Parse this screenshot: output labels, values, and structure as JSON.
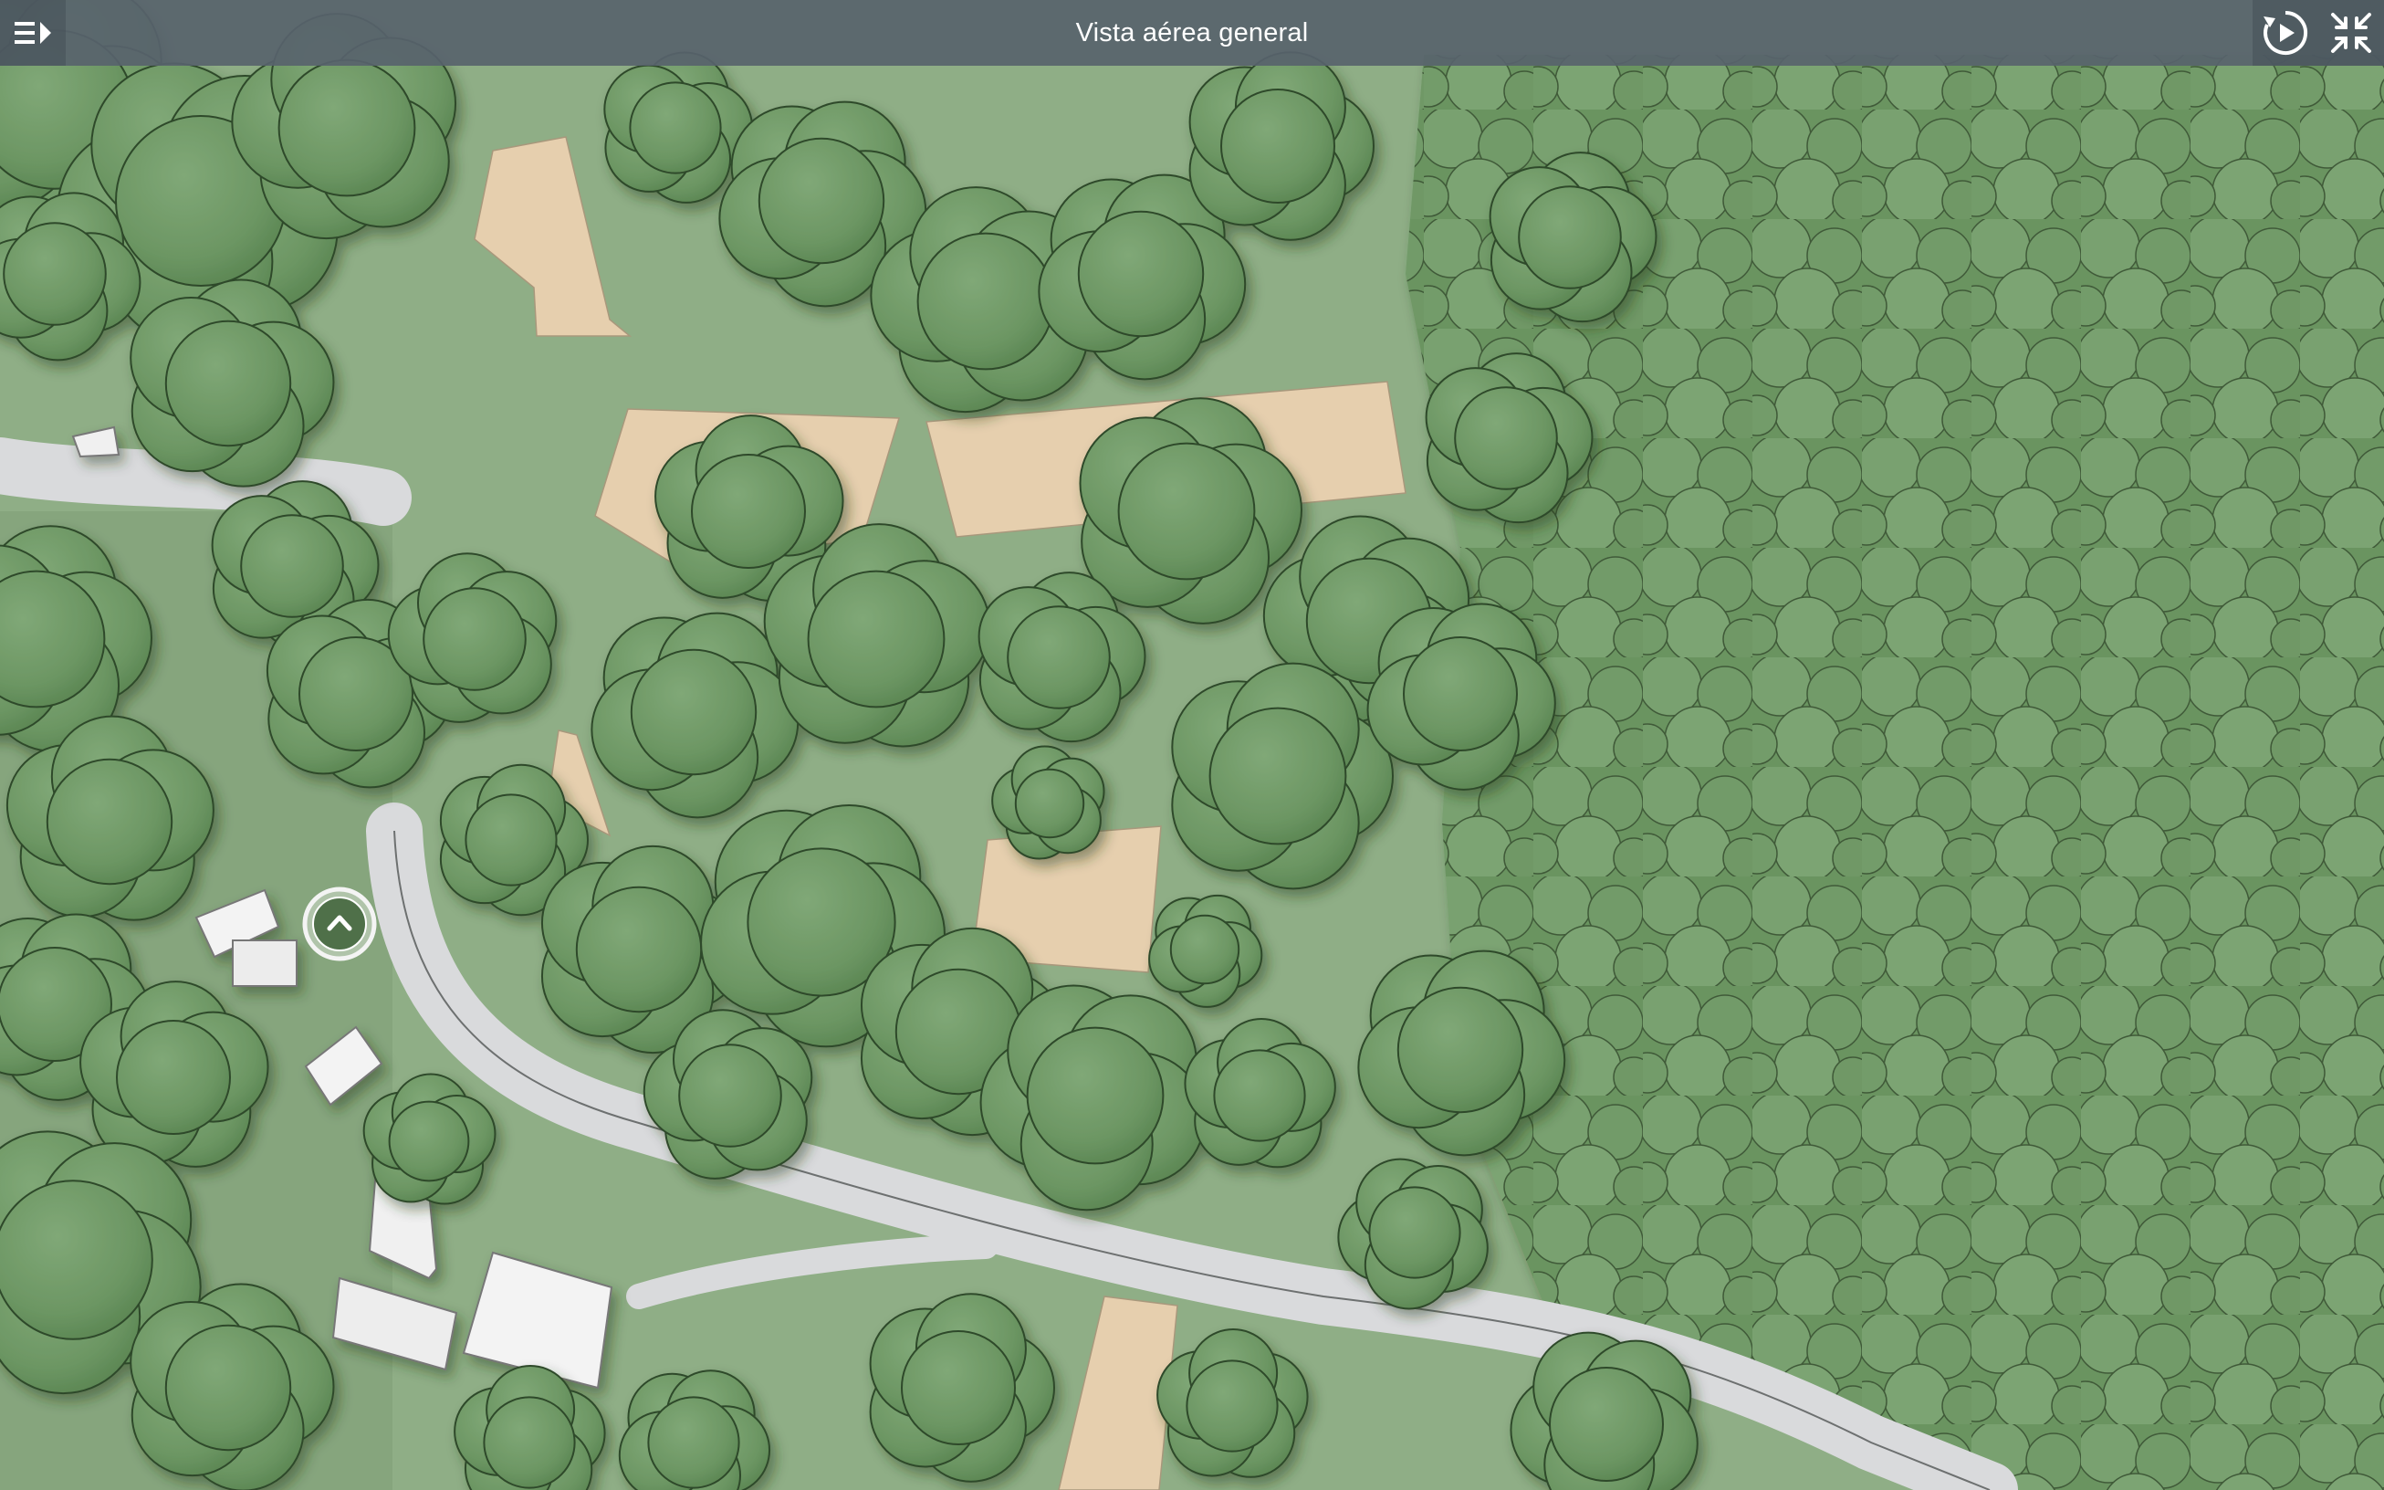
{
  "header": {
    "title": "Vista aérea general",
    "menu_icon": "menu-toggle-icon",
    "autoplay_icon": "autoplay-rotate-icon",
    "fullscreen_icon": "exit-fullscreen-icon"
  },
  "map": {
    "hotspot_icon": "chevron-up-icon",
    "colors": {
      "ground": "#8fae86",
      "tree": "#6f9a66",
      "tree_dark": "#5f8a58",
      "road": "#dfe0e2",
      "field": "#e6cfae",
      "building": "#f1f1f1",
      "toolbar": "#58636c"
    }
  }
}
